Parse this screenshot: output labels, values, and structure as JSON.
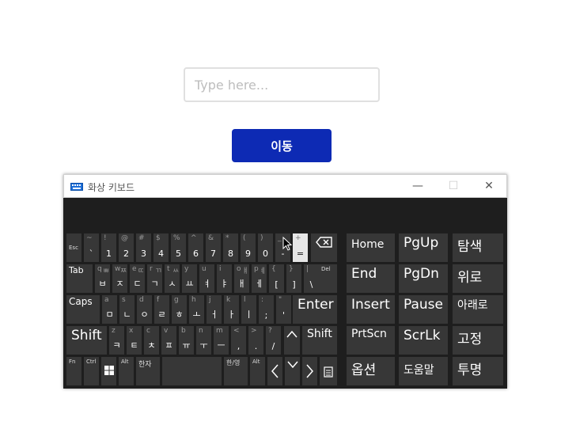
{
  "page": {
    "input_placeholder": "Type here...",
    "move_button": "이동"
  },
  "osk": {
    "title": "화상 키보드",
    "minimize": "—",
    "maximize": "☐",
    "close": "✕",
    "keys": {
      "esc": "Esc",
      "tab": "Tab",
      "del": "Del",
      "caps": "Caps",
      "enter": "Enter",
      "shift": "Shift",
      "fn": "Fn",
      "ctrl": "Ctrl",
      "alt": "Alt",
      "hanja": "한자",
      "hanyeong": "한/영",
      "alt_r": "Alt",
      "home": "Home",
      "pgup": "PgUp",
      "tamsaek": "탐색",
      "end": "End",
      "pgdn": "PgDn",
      "wiro": "위로",
      "insert": "Insert",
      "pause": "Pause",
      "araero": "아래로",
      "prtscn": "PrtScn",
      "scrlk": "ScrLk",
      "gojeong": "고정",
      "option": "옵션",
      "help": "도움말",
      "tumyeong": "투명"
    },
    "row1": [
      {
        "t": "~",
        "b": "`"
      },
      {
        "t": "!",
        "b": "1"
      },
      {
        "t": "@",
        "b": "2"
      },
      {
        "t": "#",
        "b": "3"
      },
      {
        "t": "$",
        "b": "4"
      },
      {
        "t": "%",
        "b": "5"
      },
      {
        "t": "^",
        "b": "6"
      },
      {
        "t": "&",
        "b": "7"
      },
      {
        "t": "*",
        "b": "8"
      },
      {
        "t": "(",
        "b": "9"
      },
      {
        "t": ")",
        "b": "0"
      },
      {
        "t": "_",
        "b": "-"
      },
      {
        "t": "+",
        "b": "="
      }
    ],
    "row2": [
      {
        "t": "q",
        "s": "ㅃ",
        "b": "ㅂ"
      },
      {
        "t": "w",
        "s": "ㅉ",
        "b": "ㅈ"
      },
      {
        "t": "e",
        "s": "ㄸ",
        "b": "ㄷ"
      },
      {
        "t": "r",
        "s": "ㄲ",
        "b": "ㄱ"
      },
      {
        "t": "t",
        "s": "ㅆ",
        "b": "ㅅ"
      },
      {
        "t": "y",
        "s": "",
        "b": "ㅛ"
      },
      {
        "t": "u",
        "s": "",
        "b": "ㅕ"
      },
      {
        "t": "i",
        "s": "",
        "b": "ㅑ"
      },
      {
        "t": "o",
        "s": "ㅒ",
        "b": "ㅐ"
      },
      {
        "t": "p",
        "s": "ㅖ",
        "b": "ㅔ"
      },
      {
        "t": "{",
        "s": "",
        "b": "["
      },
      {
        "t": "}",
        "s": "",
        "b": "]"
      },
      {
        "t": "|",
        "s": "",
        "b": "\\"
      }
    ],
    "row3": [
      {
        "t": "a",
        "b": "ㅁ"
      },
      {
        "t": "s",
        "b": "ㄴ"
      },
      {
        "t": "d",
        "b": "ㅇ"
      },
      {
        "t": "f",
        "b": "ㄹ"
      },
      {
        "t": "g",
        "b": "ㅎ"
      },
      {
        "t": "h",
        "b": "ㅗ"
      },
      {
        "t": "j",
        "b": "ㅓ"
      },
      {
        "t": "k",
        "b": "ㅏ"
      },
      {
        "t": "l",
        "b": "ㅣ"
      },
      {
        "t": ":",
        "b": ";"
      },
      {
        "t": "\"",
        "b": "'"
      }
    ],
    "row4": [
      {
        "t": "z",
        "b": "ㅋ"
      },
      {
        "t": "x",
        "b": "ㅌ"
      },
      {
        "t": "c",
        "b": "ㅊ"
      },
      {
        "t": "v",
        "b": "ㅍ"
      },
      {
        "t": "b",
        "b": "ㅠ"
      },
      {
        "t": "n",
        "b": "ㅜ"
      },
      {
        "t": "m",
        "b": "ㅡ"
      },
      {
        "t": "<",
        "b": ","
      },
      {
        "t": ">",
        "b": "."
      },
      {
        "t": "?",
        "b": "/"
      }
    ],
    "arrows": {
      "up": "^",
      "left": "<",
      "down": "v",
      "right": ">"
    }
  }
}
